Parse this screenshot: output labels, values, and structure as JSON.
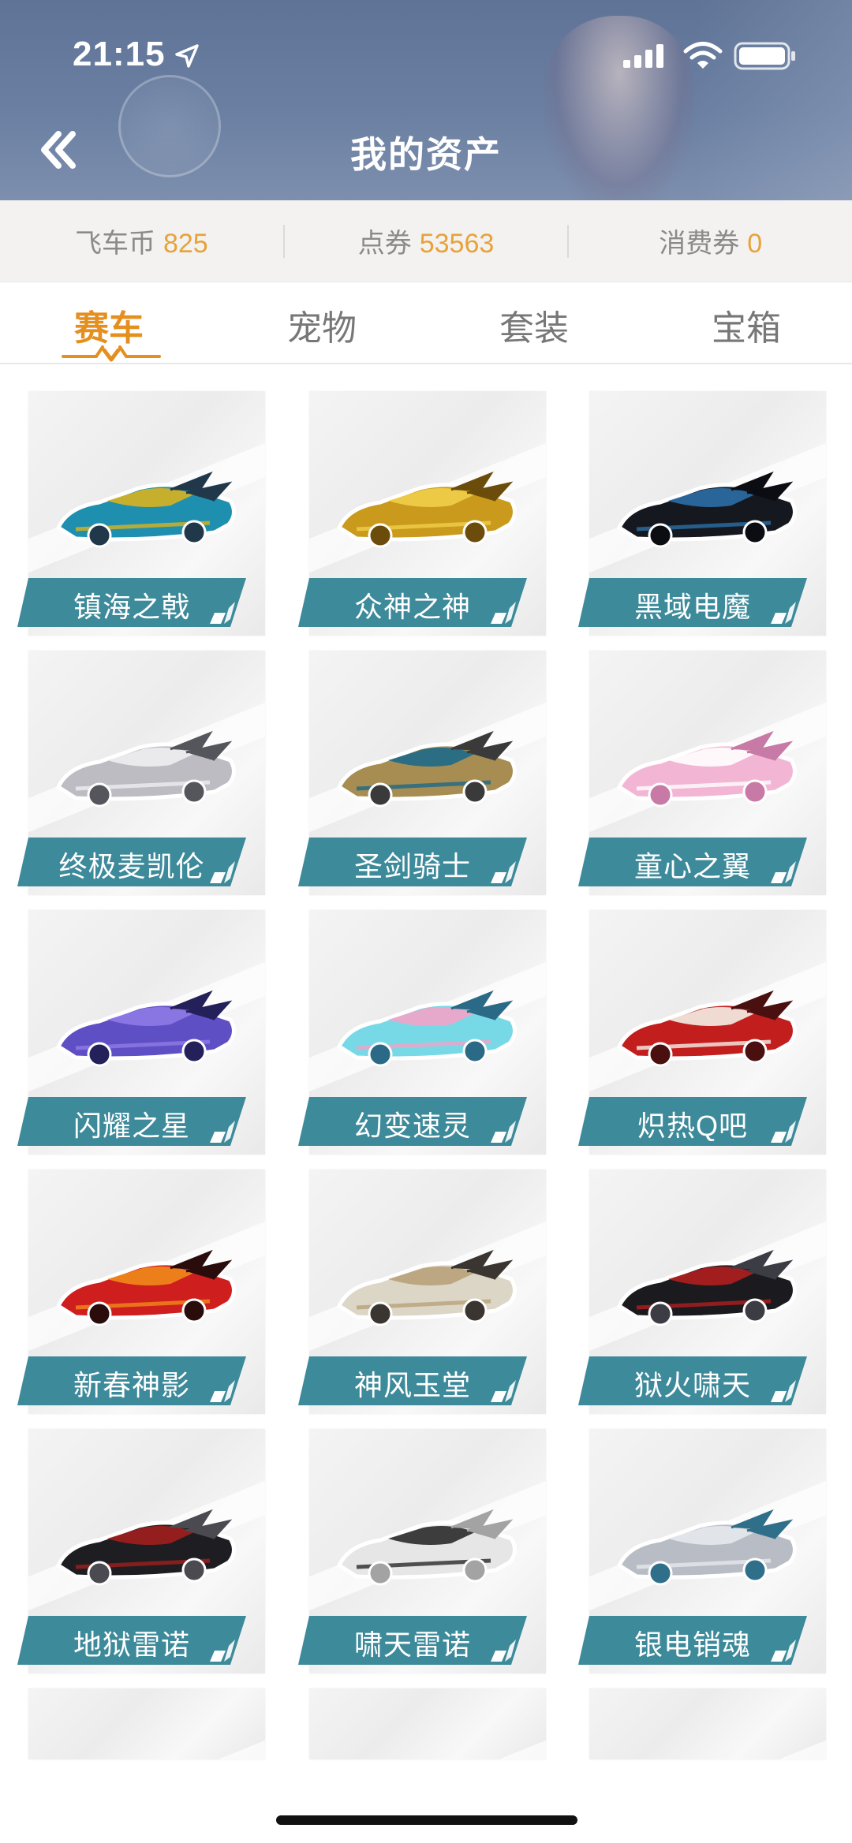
{
  "status": {
    "time": "21:15"
  },
  "header": {
    "title": "我的资产"
  },
  "currency": [
    {
      "label": "飞车币",
      "value": "825"
    },
    {
      "label": "点券",
      "value": "53563"
    },
    {
      "label": "消费券",
      "value": "0"
    }
  ],
  "tabs": [
    {
      "label": "赛车",
      "active": true
    },
    {
      "label": "宠物",
      "active": false
    },
    {
      "label": "套装",
      "active": false
    },
    {
      "label": "宝箱",
      "active": false
    }
  ],
  "colors": {
    "accent": "#e58f1e",
    "banner": "#3d8a9a",
    "currency_value": "#e6a33a"
  },
  "cars": [
    {
      "name": "镇海之戟",
      "palette": [
        "#1f8fb0",
        "#d8b21e",
        "#20384a"
      ]
    },
    {
      "name": "众神之神",
      "palette": [
        "#c99a1c",
        "#f1cf4a",
        "#6b4c0a"
      ]
    },
    {
      "name": "黑域电魔",
      "palette": [
        "#15191f",
        "#2b6ea6",
        "#0b0d12"
      ]
    },
    {
      "name": "终极麦凯伦",
      "palette": [
        "#bcbcc2",
        "#eeeef2",
        "#55565c"
      ]
    },
    {
      "name": "圣剑骑士",
      "palette": [
        "#a78d52",
        "#1e6a8a",
        "#3a3a3a"
      ]
    },
    {
      "name": "童心之翼",
      "palette": [
        "#f2b6d4",
        "#ffffff",
        "#c77aa6"
      ]
    },
    {
      "name": "闪耀之星",
      "palette": [
        "#5e4fc4",
        "#8f7ae6",
        "#23205a"
      ]
    },
    {
      "name": "幻变速灵",
      "palette": [
        "#78d9e6",
        "#f2a3c8",
        "#2b6a86"
      ]
    },
    {
      "name": "炽热Q吧",
      "palette": [
        "#c21e1e",
        "#f4f0e6",
        "#4a1010"
      ]
    },
    {
      "name": "新春神影",
      "palette": [
        "#cf1e1e",
        "#f08a1a",
        "#2b0c0c"
      ]
    },
    {
      "name": "神风玉堂",
      "palette": [
        "#dcd6c6",
        "#b8a27a",
        "#3a3530"
      ]
    },
    {
      "name": "狱火啸天",
      "palette": [
        "#1b1b1f",
        "#b01e1e",
        "#3c3c44"
      ]
    },
    {
      "name": "地狱雷诺",
      "palette": [
        "#1e1e22",
        "#a11e1e",
        "#4a4a50"
      ]
    },
    {
      "name": "啸天雷诺",
      "palette": [
        "#e6e6e6",
        "#2a2a2a",
        "#a3a3a3"
      ]
    },
    {
      "name": "银电销魂",
      "palette": [
        "#b8bcc4",
        "#e6e9ee",
        "#2f6f8a"
      ]
    },
    {
      "name": "",
      "palette": [
        "#eeeeee",
        "#eeeeee",
        "#eeeeee"
      ]
    },
    {
      "name": "",
      "palette": [
        "#eeeeee",
        "#eeeeee",
        "#eeeeee"
      ]
    },
    {
      "name": "",
      "palette": [
        "#eeeeee",
        "#eeeeee",
        "#eeeeee"
      ]
    }
  ]
}
